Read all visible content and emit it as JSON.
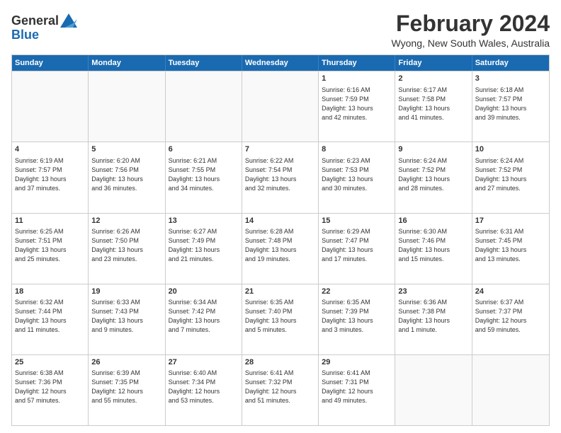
{
  "logo": {
    "general": "General",
    "blue": "Blue"
  },
  "title": {
    "month_year": "February 2024",
    "location": "Wyong, New South Wales, Australia"
  },
  "calendar": {
    "headers": [
      "Sunday",
      "Monday",
      "Tuesday",
      "Wednesday",
      "Thursday",
      "Friday",
      "Saturday"
    ],
    "rows": [
      [
        {
          "day": "",
          "info": ""
        },
        {
          "day": "",
          "info": ""
        },
        {
          "day": "",
          "info": ""
        },
        {
          "day": "",
          "info": ""
        },
        {
          "day": "1",
          "info": "Sunrise: 6:16 AM\nSunset: 7:59 PM\nDaylight: 13 hours\nand 42 minutes."
        },
        {
          "day": "2",
          "info": "Sunrise: 6:17 AM\nSunset: 7:58 PM\nDaylight: 13 hours\nand 41 minutes."
        },
        {
          "day": "3",
          "info": "Sunrise: 6:18 AM\nSunset: 7:57 PM\nDaylight: 13 hours\nand 39 minutes."
        }
      ],
      [
        {
          "day": "4",
          "info": "Sunrise: 6:19 AM\nSunset: 7:57 PM\nDaylight: 13 hours\nand 37 minutes."
        },
        {
          "day": "5",
          "info": "Sunrise: 6:20 AM\nSunset: 7:56 PM\nDaylight: 13 hours\nand 36 minutes."
        },
        {
          "day": "6",
          "info": "Sunrise: 6:21 AM\nSunset: 7:55 PM\nDaylight: 13 hours\nand 34 minutes."
        },
        {
          "day": "7",
          "info": "Sunrise: 6:22 AM\nSunset: 7:54 PM\nDaylight: 13 hours\nand 32 minutes."
        },
        {
          "day": "8",
          "info": "Sunrise: 6:23 AM\nSunset: 7:53 PM\nDaylight: 13 hours\nand 30 minutes."
        },
        {
          "day": "9",
          "info": "Sunrise: 6:24 AM\nSunset: 7:52 PM\nDaylight: 13 hours\nand 28 minutes."
        },
        {
          "day": "10",
          "info": "Sunrise: 6:24 AM\nSunset: 7:52 PM\nDaylight: 13 hours\nand 27 minutes."
        }
      ],
      [
        {
          "day": "11",
          "info": "Sunrise: 6:25 AM\nSunset: 7:51 PM\nDaylight: 13 hours\nand 25 minutes."
        },
        {
          "day": "12",
          "info": "Sunrise: 6:26 AM\nSunset: 7:50 PM\nDaylight: 13 hours\nand 23 minutes."
        },
        {
          "day": "13",
          "info": "Sunrise: 6:27 AM\nSunset: 7:49 PM\nDaylight: 13 hours\nand 21 minutes."
        },
        {
          "day": "14",
          "info": "Sunrise: 6:28 AM\nSunset: 7:48 PM\nDaylight: 13 hours\nand 19 minutes."
        },
        {
          "day": "15",
          "info": "Sunrise: 6:29 AM\nSunset: 7:47 PM\nDaylight: 13 hours\nand 17 minutes."
        },
        {
          "day": "16",
          "info": "Sunrise: 6:30 AM\nSunset: 7:46 PM\nDaylight: 13 hours\nand 15 minutes."
        },
        {
          "day": "17",
          "info": "Sunrise: 6:31 AM\nSunset: 7:45 PM\nDaylight: 13 hours\nand 13 minutes."
        }
      ],
      [
        {
          "day": "18",
          "info": "Sunrise: 6:32 AM\nSunset: 7:44 PM\nDaylight: 13 hours\nand 11 minutes."
        },
        {
          "day": "19",
          "info": "Sunrise: 6:33 AM\nSunset: 7:43 PM\nDaylight: 13 hours\nand 9 minutes."
        },
        {
          "day": "20",
          "info": "Sunrise: 6:34 AM\nSunset: 7:42 PM\nDaylight: 13 hours\nand 7 minutes."
        },
        {
          "day": "21",
          "info": "Sunrise: 6:35 AM\nSunset: 7:40 PM\nDaylight: 13 hours\nand 5 minutes."
        },
        {
          "day": "22",
          "info": "Sunrise: 6:35 AM\nSunset: 7:39 PM\nDaylight: 13 hours\nand 3 minutes."
        },
        {
          "day": "23",
          "info": "Sunrise: 6:36 AM\nSunset: 7:38 PM\nDaylight: 13 hours\nand 1 minute."
        },
        {
          "day": "24",
          "info": "Sunrise: 6:37 AM\nSunset: 7:37 PM\nDaylight: 12 hours\nand 59 minutes."
        }
      ],
      [
        {
          "day": "25",
          "info": "Sunrise: 6:38 AM\nSunset: 7:36 PM\nDaylight: 12 hours\nand 57 minutes."
        },
        {
          "day": "26",
          "info": "Sunrise: 6:39 AM\nSunset: 7:35 PM\nDaylight: 12 hours\nand 55 minutes."
        },
        {
          "day": "27",
          "info": "Sunrise: 6:40 AM\nSunset: 7:34 PM\nDaylight: 12 hours\nand 53 minutes."
        },
        {
          "day": "28",
          "info": "Sunrise: 6:41 AM\nSunset: 7:32 PM\nDaylight: 12 hours\nand 51 minutes."
        },
        {
          "day": "29",
          "info": "Sunrise: 6:41 AM\nSunset: 7:31 PM\nDaylight: 12 hours\nand 49 minutes."
        },
        {
          "day": "",
          "info": ""
        },
        {
          "day": "",
          "info": ""
        }
      ]
    ]
  }
}
